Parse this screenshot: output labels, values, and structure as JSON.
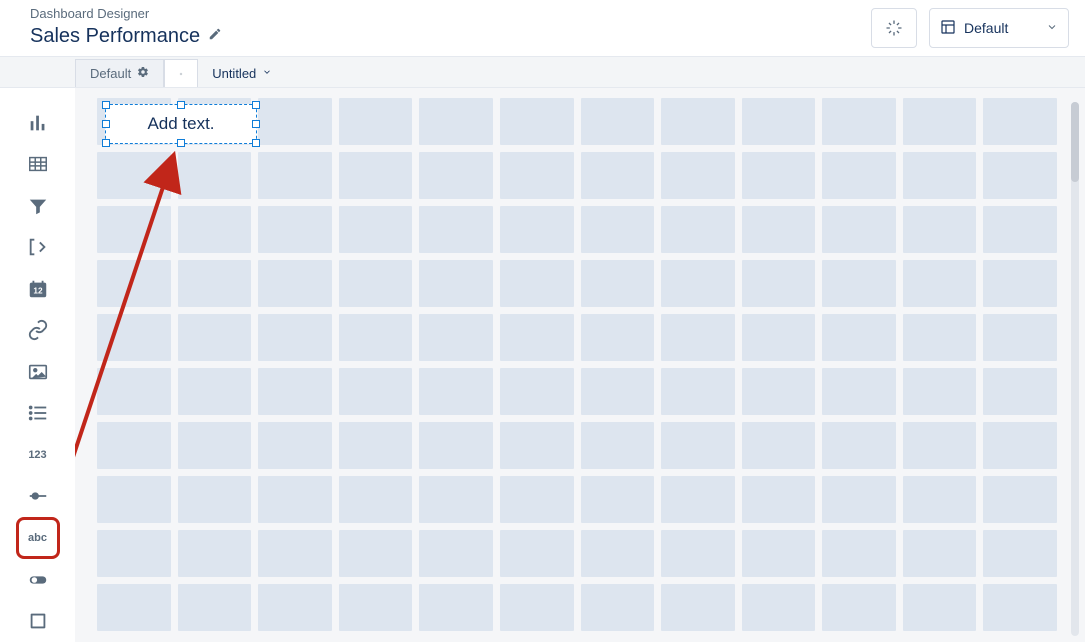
{
  "header": {
    "breadcrumb": "Dashboard Designer",
    "title": "Sales Performance",
    "layout_label": "Default"
  },
  "tabs": {
    "active_label": "Default",
    "secondary_label": "Untitled"
  },
  "palette": {
    "items": [
      {
        "name": "chart-icon"
      },
      {
        "name": "table-icon"
      },
      {
        "name": "filter-icon"
      },
      {
        "name": "range-icon"
      },
      {
        "name": "date-icon",
        "badge": "12"
      },
      {
        "name": "link-icon"
      },
      {
        "name": "image-icon"
      },
      {
        "name": "list-icon"
      },
      {
        "name": "number-icon",
        "text": "123"
      },
      {
        "name": "slider-icon"
      },
      {
        "name": "text-icon",
        "text": "abc",
        "highlight": true
      },
      {
        "name": "toggle-icon"
      },
      {
        "name": "container-icon"
      }
    ]
  },
  "canvas": {
    "text_widget_placeholder": "Add text.",
    "rows": 10,
    "cols": 12
  },
  "colors": {
    "highlight": "#c1261a",
    "selection": "#0f7dd8",
    "grid_cell": "#dde5ef"
  }
}
